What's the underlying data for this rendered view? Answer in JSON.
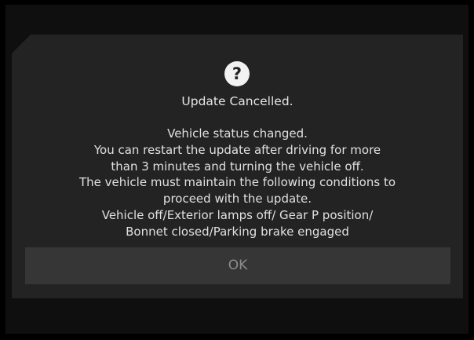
{
  "dialog": {
    "icon": "question-mark-icon",
    "icon_glyph": "?",
    "title": "Update Cancelled.",
    "message_lines": [
      "Vehicle status changed.",
      "You can restart the update after driving for more",
      "than 3 minutes and turning the vehicle off.",
      "The vehicle must maintain the following conditions to",
      "proceed with the update.",
      "Vehicle off/Exterior lamps off/ Gear P position/",
      "Bonnet closed/Parking brake engaged"
    ],
    "ok_label": "OK"
  },
  "colors": {
    "background": "#000000",
    "screen": "#0f0f0f",
    "panel": "#232323",
    "button": "#363636",
    "button_text": "#8c8c8c",
    "text": "#e6e6e6"
  }
}
